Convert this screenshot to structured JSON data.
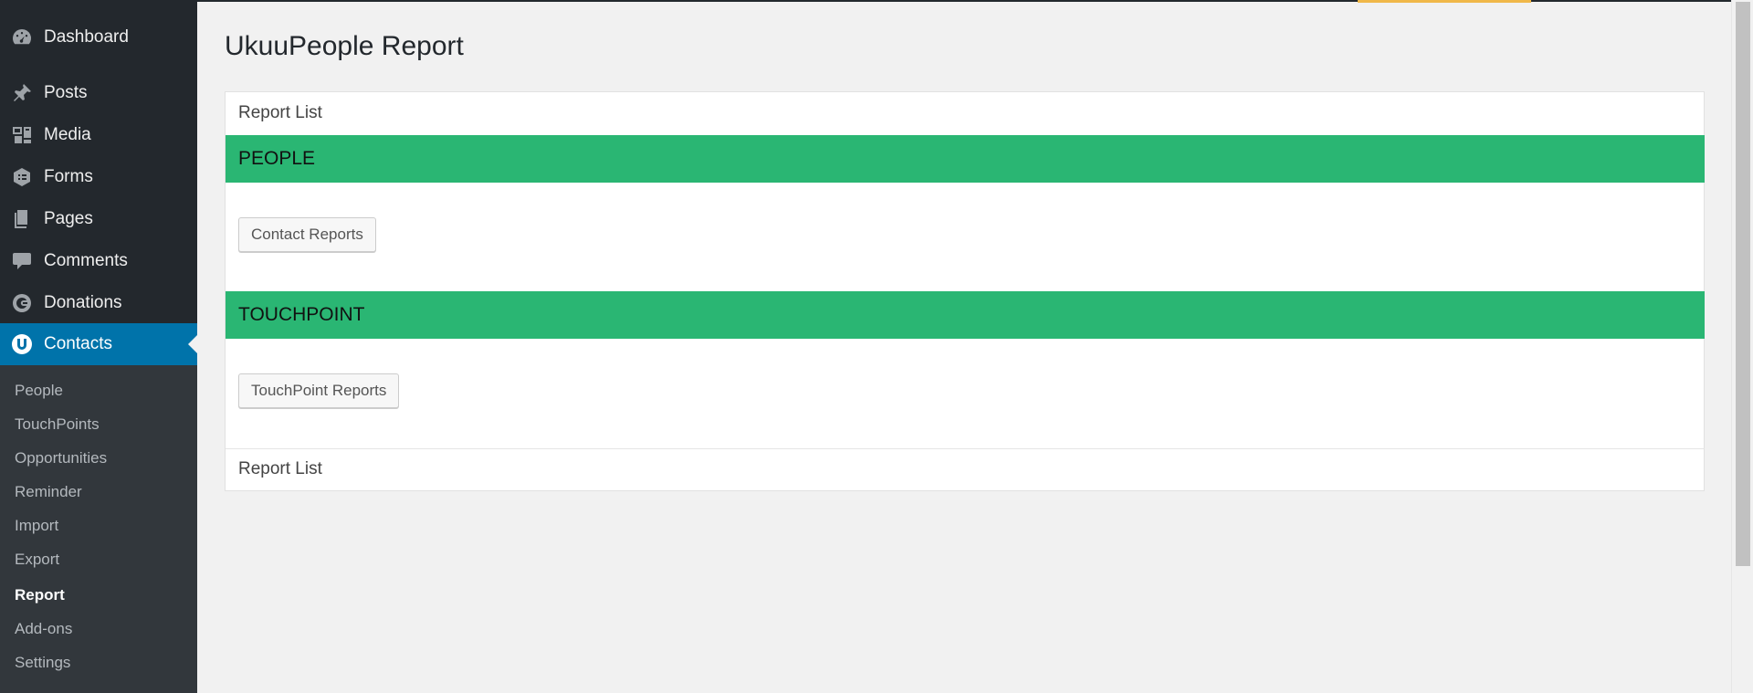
{
  "sidebar": {
    "menu": [
      {
        "label": "Dashboard",
        "icon": "dashboard-icon"
      },
      {
        "label": "Posts",
        "icon": "pin-icon"
      },
      {
        "label": "Media",
        "icon": "media-icon"
      },
      {
        "label": "Forms",
        "icon": "forms-icon"
      },
      {
        "label": "Pages",
        "icon": "pages-icon"
      },
      {
        "label": "Comments",
        "icon": "comment-icon"
      },
      {
        "label": "Donations",
        "icon": "donations-icon"
      },
      {
        "label": "Contacts",
        "icon": "ukuu-logo-icon",
        "active": true
      }
    ],
    "submenu": [
      {
        "label": "People"
      },
      {
        "label": "TouchPoints"
      },
      {
        "label": "Opportunities"
      },
      {
        "label": "Reminder"
      },
      {
        "label": "Import"
      },
      {
        "label": "Export"
      },
      {
        "label": "Report",
        "current": true
      },
      {
        "label": "Add-ons"
      },
      {
        "label": "Settings"
      }
    ]
  },
  "page": {
    "title": "UkuuPeople Report",
    "header_label": "Report List",
    "footer_label": "Report List",
    "sections": [
      {
        "title": "PEOPLE",
        "button": "Contact Reports"
      },
      {
        "title": "TOUCHPOINT",
        "button": "TouchPoint Reports"
      }
    ]
  },
  "colors": {
    "sidebar_bg": "#23282d",
    "submenu_bg": "#32373c",
    "active_bg": "#0073aa",
    "section_green": "#2ab673",
    "accent_yellow": "#f0b849"
  }
}
